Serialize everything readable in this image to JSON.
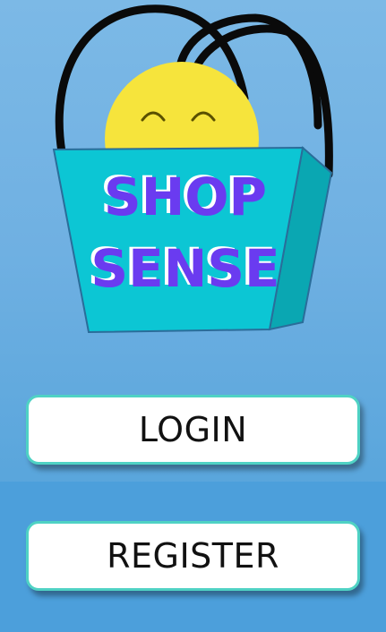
{
  "logo": {
    "line1": "SHOP",
    "line2": "SENSE"
  },
  "buttons": {
    "login_label": "LOGIN",
    "register_label": "REGISTER"
  },
  "colors": {
    "bag_front": "#0cc6d4",
    "bag_side": "#0aa7b2",
    "bag_outline": "#2a6d9a",
    "sun": "#f6e43c",
    "handles": "#0a0a0a",
    "logo_text": "#6a3bf0",
    "button_border": "#4fd2c4"
  },
  "icons": {
    "logo": "shopping-bag-smiley-icon"
  }
}
